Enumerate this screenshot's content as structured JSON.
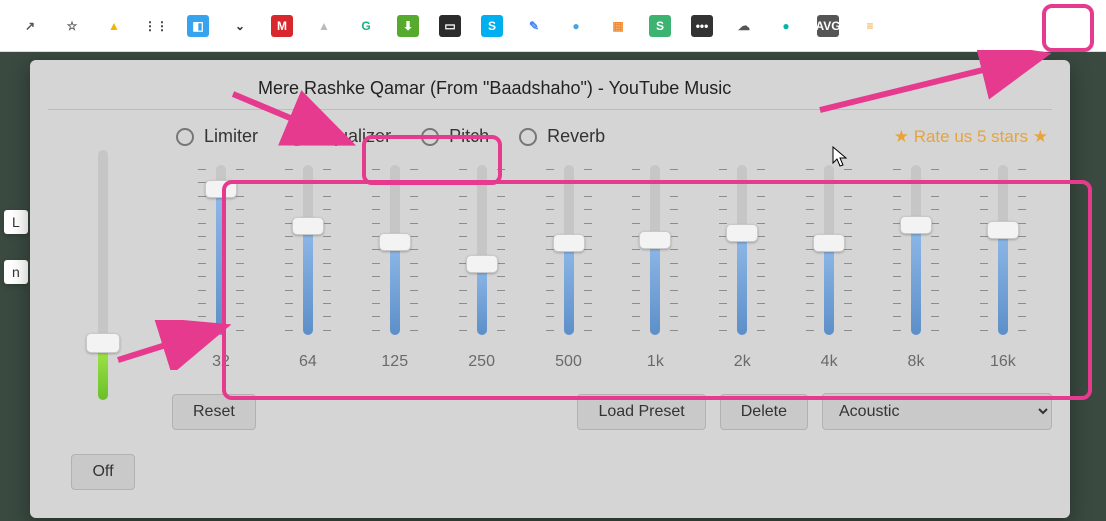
{
  "toolbar": {
    "icons": [
      {
        "name": "open-in-new-icon",
        "glyph": "↗",
        "bg": "#fff",
        "fg": "#555"
      },
      {
        "name": "star-icon",
        "glyph": "☆",
        "bg": "#fff",
        "fg": "#555"
      },
      {
        "name": "drive-icon",
        "glyph": "▲",
        "bg": "#fff",
        "fg": "#f4b400"
      },
      {
        "name": "molecule-icon",
        "glyph": "⋮⋮",
        "bg": "#fff",
        "fg": "#333"
      },
      {
        "name": "window-icon",
        "glyph": "◧",
        "bg": "#36a3ef",
        "fg": "#fff"
      },
      {
        "name": "pocket-icon",
        "glyph": "⌄",
        "bg": "#fff",
        "fg": "#333"
      },
      {
        "name": "mega-icon",
        "glyph": "M",
        "bg": "#d9272e",
        "fg": "#fff"
      },
      {
        "name": "arrow-up-icon",
        "glyph": "▲",
        "bg": "#fff",
        "fg": "#bbb"
      },
      {
        "name": "grammarly-icon",
        "glyph": "G",
        "bg": "#fff",
        "fg": "#19b37b"
      },
      {
        "name": "download-icon",
        "glyph": "⬇",
        "bg": "#56ab2f",
        "fg": "#fff"
      },
      {
        "name": "video-icon",
        "glyph": "▭",
        "bg": "#2b2b2b",
        "fg": "#fff"
      },
      {
        "name": "skype-icon",
        "glyph": "S",
        "bg": "#00aff0",
        "fg": "#fff"
      },
      {
        "name": "screenshot-icon",
        "glyph": "✎",
        "bg": "#fff",
        "fg": "#4285f4"
      },
      {
        "name": "globe-icon",
        "glyph": "●",
        "bg": "#fff",
        "fg": "#4aa3df"
      },
      {
        "name": "gallery-icon",
        "glyph": "▦",
        "bg": "#fff",
        "fg": "#f28b30"
      },
      {
        "name": "shop-icon",
        "glyph": "S",
        "bg": "#3cb371",
        "fg": "#fff"
      },
      {
        "name": "lastpass-icon",
        "glyph": "•••",
        "bg": "#333",
        "fg": "#fff"
      },
      {
        "name": "cloud-icon",
        "glyph": "☁",
        "bg": "#fff",
        "fg": "#555"
      },
      {
        "name": "bookmark-icon",
        "glyph": "●",
        "bg": "#fff",
        "fg": "#00b9a5"
      },
      {
        "name": "avg-icon",
        "glyph": "AVG",
        "bg": "#555",
        "fg": "#fff"
      },
      {
        "name": "equalizer-ext-icon",
        "glyph": "≡",
        "bg": "#fff",
        "fg": "#f2a03c"
      }
    ]
  },
  "popup": {
    "title": "Mere Rashke Qamar (From \"Baadshaho\") - YouTube Music",
    "tabs": [
      {
        "id": "limiter",
        "label": "Limiter",
        "selected": false
      },
      {
        "id": "equalizer",
        "label": "Equalizer",
        "selected": true
      },
      {
        "id": "pitch",
        "label": "Pitch",
        "selected": false
      },
      {
        "id": "reverb",
        "label": "Reverb",
        "selected": false
      }
    ],
    "rate_label": "★ Rate us 5 stars ★",
    "volume": {
      "value_pct": 23
    },
    "bands": [
      {
        "freq": "32",
        "value_pct": 86
      },
      {
        "freq": "64",
        "value_pct": 64
      },
      {
        "freq": "125",
        "value_pct": 55
      },
      {
        "freq": "250",
        "value_pct": 42
      },
      {
        "freq": "500",
        "value_pct": 54
      },
      {
        "freq": "1k",
        "value_pct": 56
      },
      {
        "freq": "2k",
        "value_pct": 60
      },
      {
        "freq": "4k",
        "value_pct": 54
      },
      {
        "freq": "8k",
        "value_pct": 65
      },
      {
        "freq": "16k",
        "value_pct": 62
      }
    ],
    "buttons": {
      "off": "Off",
      "reset": "Reset",
      "load_preset": "Load Preset",
      "delete": "Delete"
    },
    "preset_selected": "Acoustic"
  }
}
